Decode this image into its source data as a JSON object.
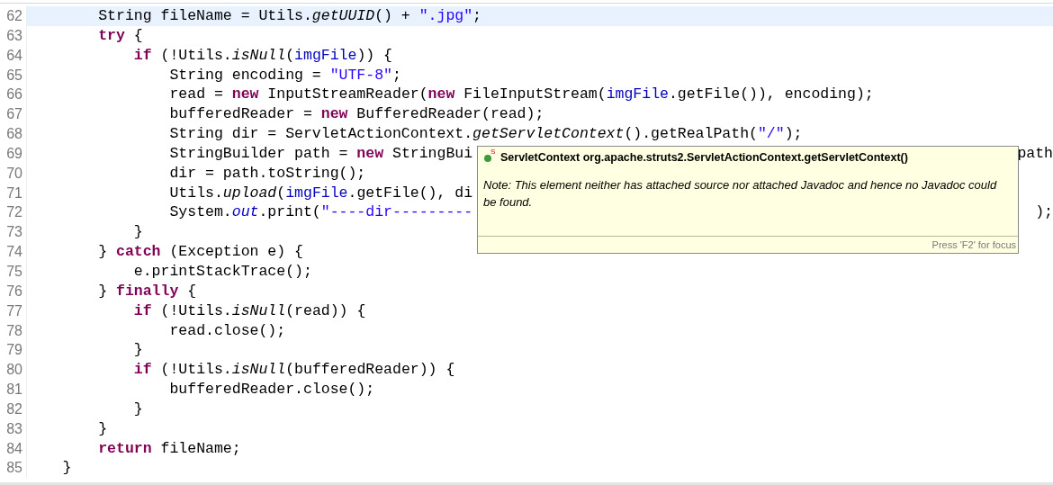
{
  "editor": {
    "lines": [
      {
        "number": "62",
        "current": true,
        "tokens": [
          {
            "text": "String fileName = Utils.",
            "kind": "plain"
          },
          {
            "text": "getUUID",
            "kind": "static_method"
          },
          {
            "text": "() + ",
            "kind": "plain"
          },
          {
            "text": "\".jpg\"",
            "kind": "string"
          },
          {
            "text": ";",
            "kind": "plain"
          }
        ]
      },
      {
        "number": "63",
        "current": false,
        "tokens": [
          {
            "text": "try",
            "kind": "keyword"
          },
          {
            "text": " {",
            "kind": "plain"
          }
        ]
      },
      {
        "number": "64",
        "current": false,
        "tokens": [
          {
            "text": "if",
            "kind": "keyword"
          },
          {
            "text": " (!Utils.",
            "kind": "plain"
          },
          {
            "text": "isNull",
            "kind": "static_method"
          },
          {
            "text": "(",
            "kind": "plain"
          },
          {
            "text": "imgFile",
            "kind": "field"
          },
          {
            "text": ")) {",
            "kind": "plain"
          }
        ]
      },
      {
        "number": "65",
        "current": false,
        "tokens": [
          {
            "text": "String encoding = ",
            "kind": "plain"
          },
          {
            "text": "\"UTF-8\"",
            "kind": "string"
          },
          {
            "text": ";",
            "kind": "plain"
          }
        ]
      },
      {
        "number": "66",
        "current": false,
        "tokens": [
          {
            "text": "read = ",
            "kind": "plain"
          },
          {
            "text": "new",
            "kind": "keyword"
          },
          {
            "text": " InputStreamReader(",
            "kind": "plain"
          },
          {
            "text": "new",
            "kind": "keyword"
          },
          {
            "text": " FileInputStream(",
            "kind": "plain"
          },
          {
            "text": "imgFile",
            "kind": "field"
          },
          {
            "text": ".getFile()), encoding);",
            "kind": "plain"
          }
        ]
      },
      {
        "number": "67",
        "current": false,
        "tokens": [
          {
            "text": "bufferedReader = ",
            "kind": "plain"
          },
          {
            "text": "new",
            "kind": "keyword"
          },
          {
            "text": " BufferedReader(read);",
            "kind": "plain"
          }
        ]
      },
      {
        "number": "68",
        "current": false,
        "tokens": [
          {
            "text": "String dir = ServletActionContext.",
            "kind": "plain"
          },
          {
            "text": "getServletContext",
            "kind": "static_method"
          },
          {
            "text": "().getRealPath(",
            "kind": "plain"
          },
          {
            "text": "\"/\"",
            "kind": "string"
          },
          {
            "text": ");",
            "kind": "plain"
          }
        ]
      },
      {
        "number": "69",
        "current": false,
        "tokens": [
          {
            "text": "StringBuilder path = ",
            "kind": "plain"
          },
          {
            "text": "new",
            "kind": "keyword"
          },
          {
            "text": " StringBui",
            "kind": "plain"
          }
        ],
        "tail": [
          {
            "text": "path",
            "kind": "plain"
          }
        ]
      },
      {
        "number": "70",
        "current": false,
        "tokens": [
          {
            "text": "dir = path.toString();",
            "kind": "plain"
          }
        ]
      },
      {
        "number": "71",
        "current": false,
        "tokens": [
          {
            "text": "Utils.",
            "kind": "plain"
          },
          {
            "text": "upload",
            "kind": "static_method"
          },
          {
            "text": "(",
            "kind": "plain"
          },
          {
            "text": "imgFile",
            "kind": "field"
          },
          {
            "text": ".getFile(), di",
            "kind": "plain"
          }
        ]
      },
      {
        "number": "72",
        "current": false,
        "tokens": [
          {
            "text": "System.",
            "kind": "plain"
          },
          {
            "text": "out",
            "kind": "static_field"
          },
          {
            "text": ".print(",
            "kind": "plain"
          },
          {
            "text": "\"----dir---------",
            "kind": "string"
          }
        ],
        "tail": [
          {
            "text": ");",
            "kind": "plain"
          }
        ]
      },
      {
        "number": "73",
        "current": false,
        "tokens": [
          {
            "text": "}",
            "kind": "plain"
          }
        ]
      },
      {
        "number": "74",
        "current": false,
        "tokens": [
          {
            "text": "} ",
            "kind": "plain"
          },
          {
            "text": "catch",
            "kind": "keyword"
          },
          {
            "text": " (Exception e) {",
            "kind": "plain"
          }
        ]
      },
      {
        "number": "75",
        "current": false,
        "tokens": [
          {
            "text": "e.printStackTrace();",
            "kind": "plain"
          }
        ]
      },
      {
        "number": "76",
        "current": false,
        "tokens": [
          {
            "text": "} ",
            "kind": "plain"
          },
          {
            "text": "finally",
            "kind": "keyword"
          },
          {
            "text": " {",
            "kind": "plain"
          }
        ]
      },
      {
        "number": "77",
        "current": false,
        "tokens": [
          {
            "text": "if",
            "kind": "keyword"
          },
          {
            "text": " (!Utils.",
            "kind": "plain"
          },
          {
            "text": "isNull",
            "kind": "static_method"
          },
          {
            "text": "(read)) {",
            "kind": "plain"
          }
        ]
      },
      {
        "number": "78",
        "current": false,
        "tokens": [
          {
            "text": "read.close();",
            "kind": "plain"
          }
        ]
      },
      {
        "number": "79",
        "current": false,
        "tokens": [
          {
            "text": "}",
            "kind": "plain"
          }
        ]
      },
      {
        "number": "80",
        "current": false,
        "tokens": [
          {
            "text": "if",
            "kind": "keyword"
          },
          {
            "text": " (!Utils.",
            "kind": "plain"
          },
          {
            "text": "isNull",
            "kind": "static_method"
          },
          {
            "text": "(bufferedReader)) {",
            "kind": "plain"
          }
        ]
      },
      {
        "number": "81",
        "current": false,
        "tokens": [
          {
            "text": "bufferedReader.close();",
            "kind": "plain"
          }
        ]
      },
      {
        "number": "82",
        "current": false,
        "tokens": [
          {
            "text": "}",
            "kind": "plain"
          }
        ]
      },
      {
        "number": "83",
        "current": false,
        "tokens": [
          {
            "text": "}",
            "kind": "plain"
          }
        ]
      },
      {
        "number": "84",
        "current": false,
        "tokens": [
          {
            "text": "return",
            "kind": "keyword"
          },
          {
            "text": " fileName;",
            "kind": "plain"
          }
        ]
      },
      {
        "number": "85",
        "current": false,
        "tokens": [
          {
            "text": "}",
            "kind": "plain"
          }
        ]
      }
    ]
  },
  "hover_popup": {
    "icon_badge": "S",
    "signature": "ServletContext org.apache.struts2.ServletActionContext.getServletContext()",
    "note": "Note: This element neither has attached source nor attached Javadoc and hence no Javadoc could be found.",
    "status": "Press 'F2' for focus"
  }
}
